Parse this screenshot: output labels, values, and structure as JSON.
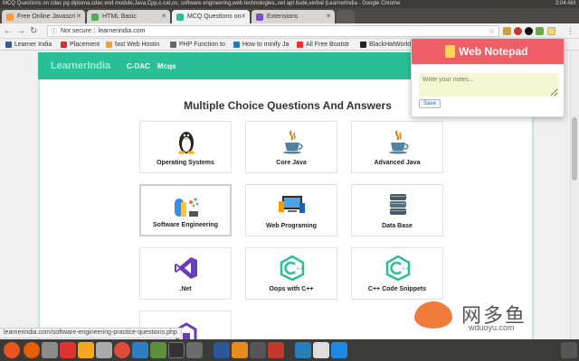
{
  "window": {
    "title": "MCQ Questions on cdac pg diploma,cdac end module,Java,Cpp,c-cat,os, software engineering,web technologies,.net apt itude,verbal |LearnerIndia - Google Chrome",
    "clock": "2:04 AM"
  },
  "tabs": [
    {
      "label": "Free Online Javascri",
      "favicon_color": "#ff9933"
    },
    {
      "label": "HTML Basic",
      "favicon_color": "#4caf50"
    },
    {
      "label": "MCQ Questions on",
      "favicon_color": "#2bbf97"
    },
    {
      "label": "Extensions",
      "favicon_color": "#7b4fc9"
    }
  ],
  "toolbar": {
    "security": "Not secure",
    "url": "learnerindia.com"
  },
  "bookmarks": [
    {
      "label": "Learner India",
      "color": "#3b5998"
    },
    {
      "label": "Placement",
      "color": "#cc3333"
    },
    {
      "label": "fast Web Hostin",
      "color": "#e8a33a"
    },
    {
      "label": "PHP Function to",
      "color": "#666666"
    },
    {
      "label": "How to minify Ja",
      "color": "#2a7ab0"
    },
    {
      "label": "All Free Bootstr",
      "color": "#e33333"
    },
    {
      "label": "BlackHatWorld",
      "color": "#222222"
    }
  ],
  "site": {
    "brand": "LearnerIndia",
    "nav": [
      "C-DAC",
      "Mcqs"
    ],
    "heading": "Multiple Choice Questions And Answers",
    "cards": [
      {
        "label": "Operating Systems",
        "icon": "linux-penguin-icon"
      },
      {
        "label": "Core Java",
        "icon": "java-cup-icon"
      },
      {
        "label": "Advanced Java",
        "icon": "java-cup-icon"
      },
      {
        "label": "Software Engineering",
        "icon": "software-engineering-icon"
      },
      {
        "label": "Web Programing",
        "icon": "web-devices-icon"
      },
      {
        "label": "Data Base",
        "icon": "database-icon"
      },
      {
        "label": ".Net",
        "icon": "visual-studio-icon"
      },
      {
        "label": "Oops with C++",
        "icon": "cpp-hexagon-icon"
      },
      {
        "label": "C++ Code Snippets",
        "icon": "cpp-hexagon-icon"
      },
      {
        "label": "",
        "icon": "cut-off-card-icon"
      }
    ]
  },
  "notepad": {
    "title": "Web Notepad",
    "placeholder": "Write your notes...",
    "save_label": "Save"
  },
  "status_url": "learnerindia.com/software-engineering-practice-questions.php",
  "watermark": {
    "cn": "网多鱼",
    "en": "wduoyu.com"
  },
  "colors": {
    "accent": "#2bbf97",
    "notepad_header": "#ef5f68"
  }
}
